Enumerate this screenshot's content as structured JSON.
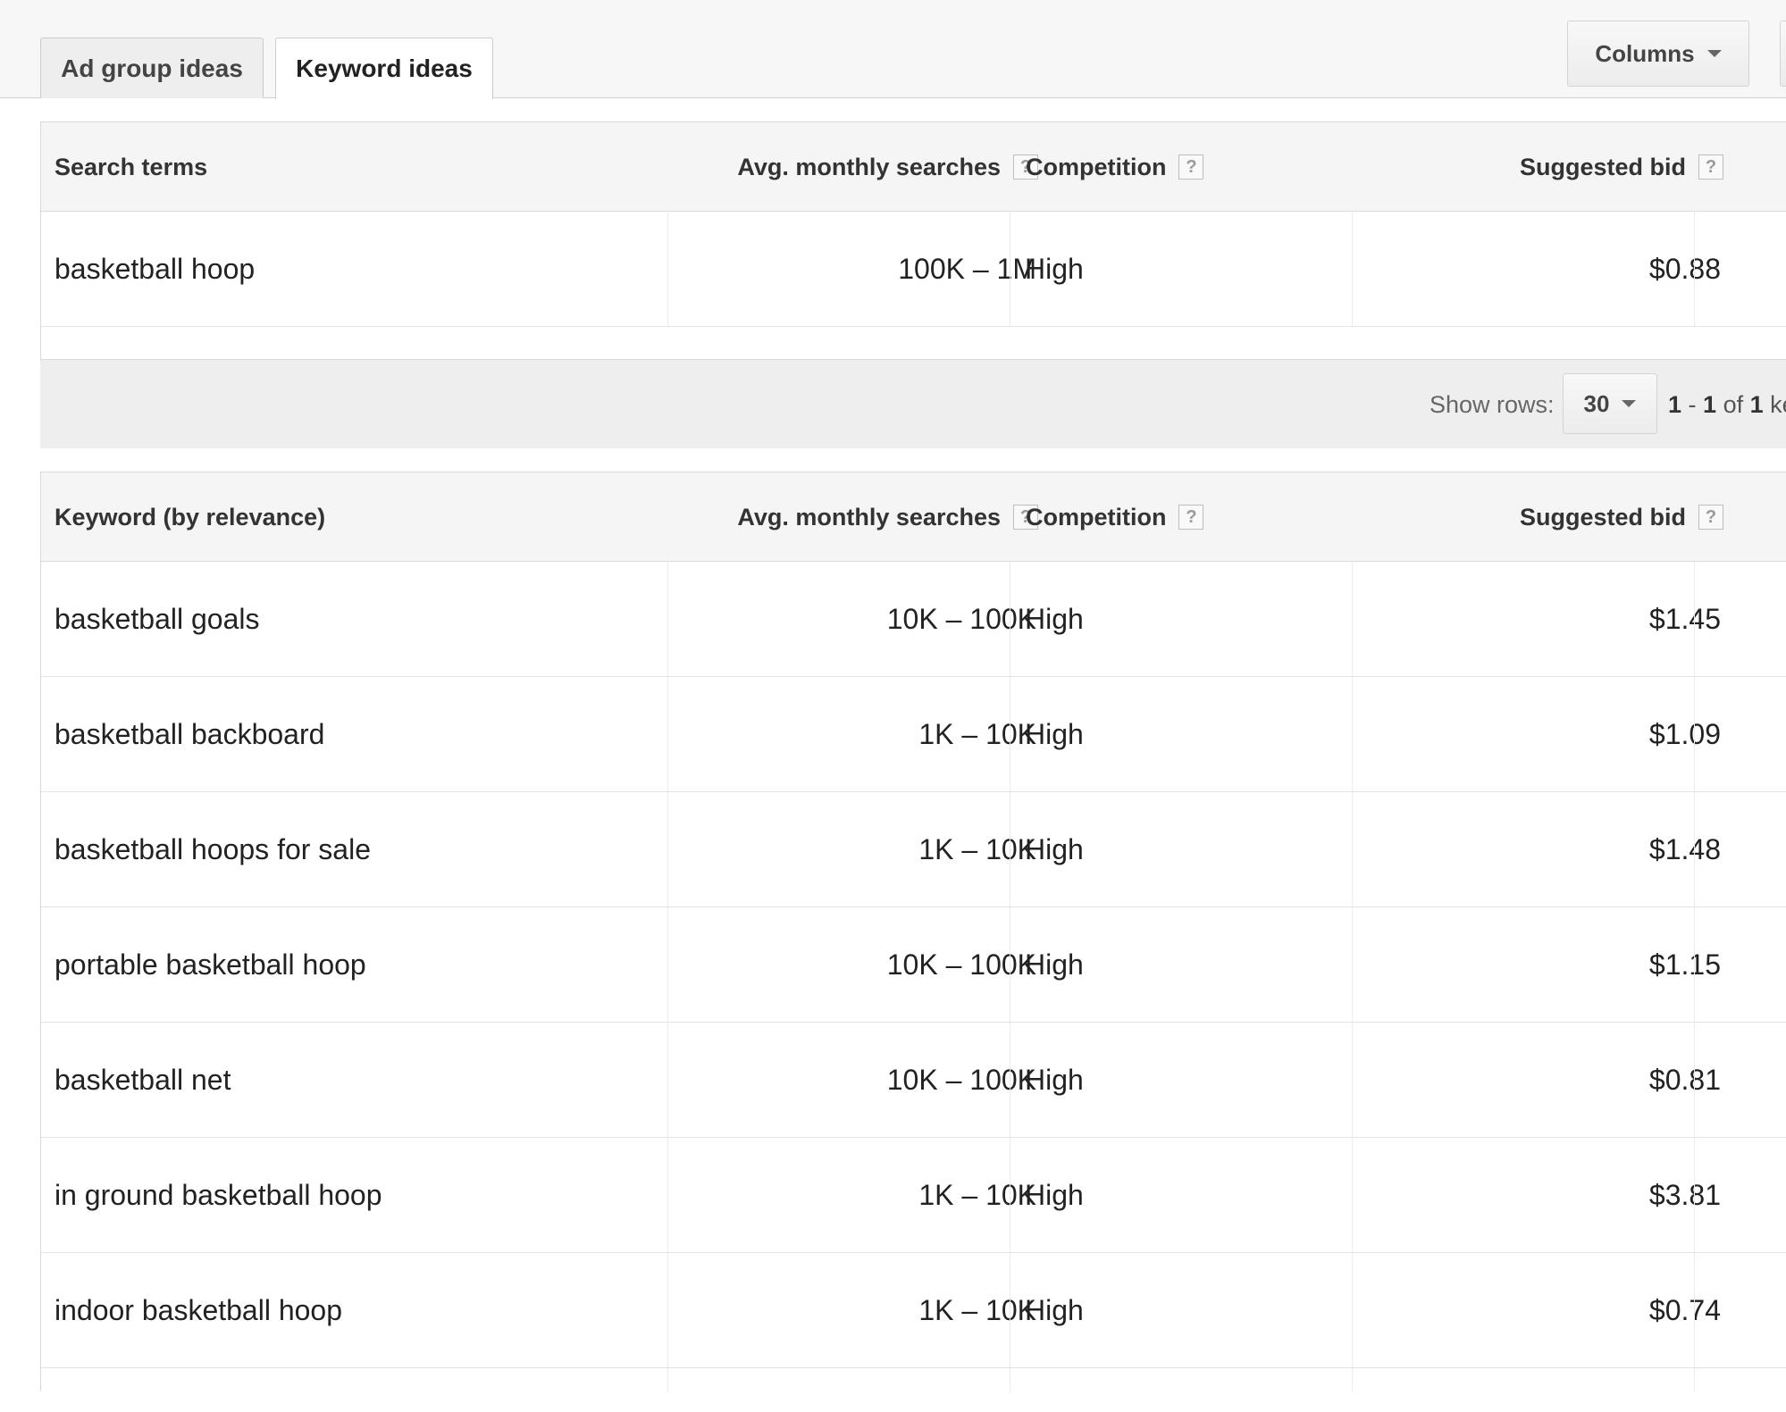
{
  "tabs": [
    {
      "label": "Ad group ideas",
      "active": false
    },
    {
      "label": "Keyword ideas",
      "active": true
    }
  ],
  "toolbar": {
    "columns_label": "Columns"
  },
  "search_terms_table": {
    "headers": {
      "term": "Search terms",
      "avg": "Avg. monthly searches",
      "competition": "Competition",
      "bid": "Suggested bid",
      "help": "?"
    },
    "rows": [
      {
        "term": "basketball hoop",
        "avg": "100K – 1M",
        "competition": "High",
        "bid": "$0.88"
      }
    ]
  },
  "pager": {
    "show_rows_label": "Show rows:",
    "rows_value": "30",
    "range_start": "1",
    "range_sep": " - ",
    "range_end": "1",
    "of_word": " of ",
    "total": "1",
    "trailing": " ke"
  },
  "keyword_table": {
    "headers": {
      "term": "Keyword (by relevance)",
      "avg": "Avg. monthly searches",
      "competition": "Competition",
      "bid": "Suggested bid",
      "help": "?"
    },
    "rows": [
      {
        "term": "basketball goals",
        "avg": "10K – 100K",
        "competition": "High",
        "bid": "$1.45"
      },
      {
        "term": "basketball backboard",
        "avg": "1K – 10K",
        "competition": "High",
        "bid": "$1.09"
      },
      {
        "term": "basketball hoops for sale",
        "avg": "1K – 10K",
        "competition": "High",
        "bid": "$1.48"
      },
      {
        "term": "portable basketball hoop",
        "avg": "10K – 100K",
        "competition": "High",
        "bid": "$1.15"
      },
      {
        "term": "basketball net",
        "avg": "10K – 100K",
        "competition": "High",
        "bid": "$0.81"
      },
      {
        "term": "in ground basketball hoop",
        "avg": "1K – 10K",
        "competition": "High",
        "bid": "$3.81"
      },
      {
        "term": "indoor basketball hoop",
        "avg": "1K – 10K",
        "competition": "High",
        "bid": "$0.74"
      }
    ]
  }
}
